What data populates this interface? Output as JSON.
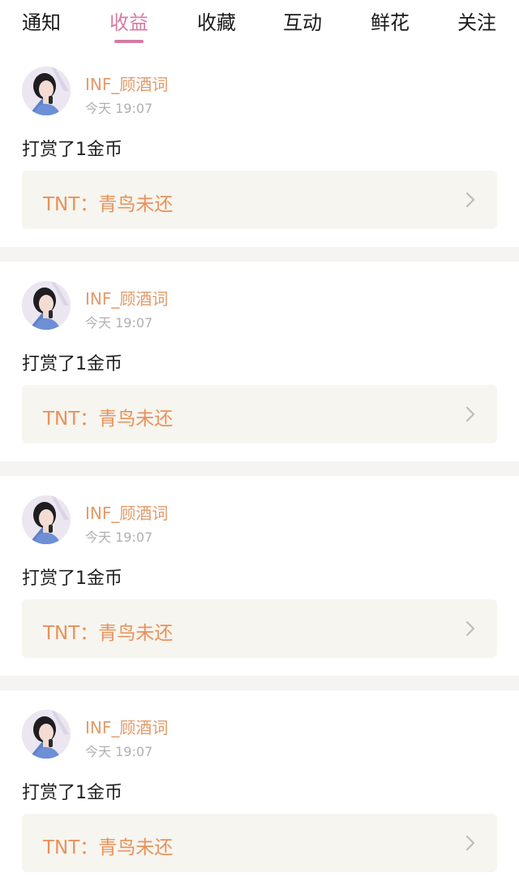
{
  "tabs": [
    {
      "label": "通知",
      "active": false
    },
    {
      "label": "收益",
      "active": true
    },
    {
      "label": "收藏",
      "active": false
    },
    {
      "label": "互动",
      "active": false
    },
    {
      "label": "鲜花",
      "active": false
    },
    {
      "label": "关注",
      "active": false
    }
  ],
  "colors": {
    "accent_tab": "#d77ba4",
    "username": "#e29a69",
    "link_text": "#e8915a",
    "link_bg": "#f6f5ef",
    "separator": "#f6f4f3"
  },
  "notifications": [
    {
      "username": "INF_顾酒词",
      "time": "今天 19:07",
      "message": "打赏了1金币",
      "link": "TNT：青鸟未还",
      "icon": "chevron-right-icon"
    },
    {
      "username": "INF_顾酒词",
      "time": "今天 19:07",
      "message": "打赏了1金币",
      "link": "TNT：青鸟未还",
      "icon": "chevron-right-icon"
    },
    {
      "username": "INF_顾酒词",
      "time": "今天 19:07",
      "message": "打赏了1金币",
      "link": "TNT：青鸟未还",
      "icon": "chevron-right-icon"
    },
    {
      "username": "INF_顾酒词",
      "time": "今天 19:07",
      "message": "打赏了1金币",
      "link": "TNT：青鸟未还",
      "icon": "chevron-right-icon"
    }
  ]
}
